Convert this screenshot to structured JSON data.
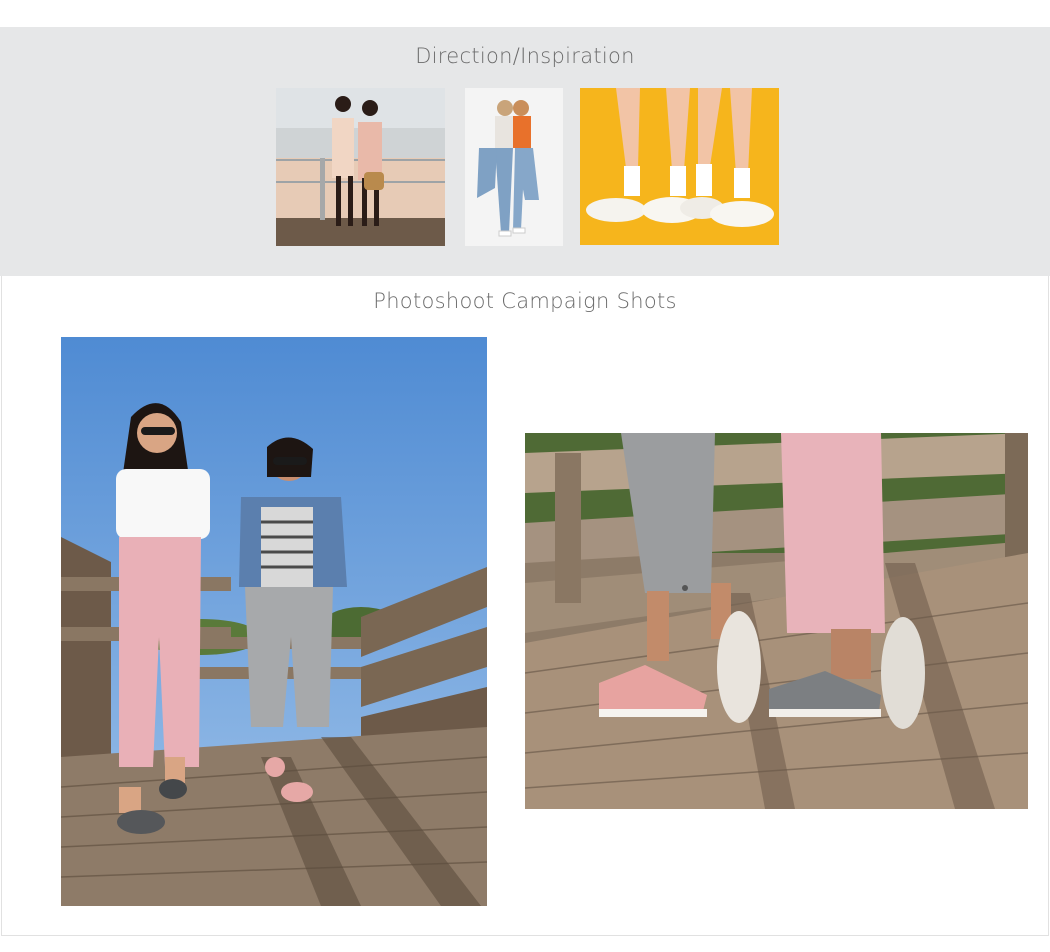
{
  "inspiration": {
    "title": "Direction/Inspiration",
    "images": [
      {
        "name": "inspiration-photo-boardwalk",
        "description_icon": "photo-icon"
      },
      {
        "name": "inspiration-photo-jeans",
        "description_icon": "photo-icon"
      },
      {
        "name": "inspiration-photo-sneakers",
        "description_icon": "photo-icon"
      }
    ]
  },
  "campaign": {
    "title": "Photoshoot Campaign Shots"
  },
  "colors": {
    "panel_gray": "#e6e7e8",
    "title_gray": "#6b6b6b",
    "sky_blue": "#5b95d6",
    "sneaker_yellow": "#f6b51c",
    "wood": "#8c7b66",
    "pants_pink": "#e9b0b7"
  }
}
